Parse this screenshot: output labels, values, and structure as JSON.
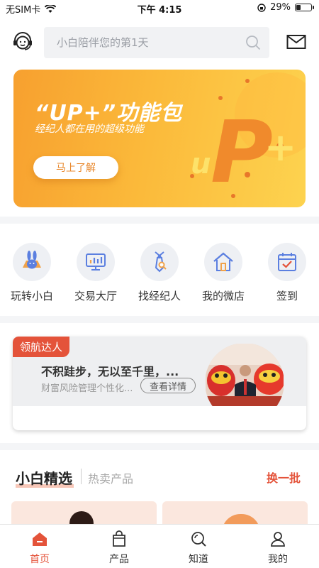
{
  "status_bar": {
    "carrier": "无SIM卡",
    "time": "下午 4:15",
    "battery": "29%",
    "battery_level": 0.29
  },
  "header": {
    "search_placeholder": "小白陪伴您的第1天",
    "icons": [
      "customer-service-icon",
      "search-icon",
      "mail-icon"
    ]
  },
  "banner": {
    "title": "“UP+”功能包",
    "subtitle": "经纪人都在用的超级功能",
    "cta": "马上了解",
    "art_text": "uP+"
  },
  "quick_nav": [
    {
      "label": "玩转小白",
      "icon": "rabbit-icon"
    },
    {
      "label": "交易大厅",
      "icon": "monitor-chart-icon"
    },
    {
      "label": "找经纪人",
      "icon": "tie-icon"
    },
    {
      "label": "我的微店",
      "icon": "house-icon"
    },
    {
      "label": "签到",
      "icon": "calendar-check-icon"
    }
  ],
  "promo_card": {
    "badge": "领航达人",
    "headline": "不积跬步，无以至千里，...",
    "description": "财富风险管理个性化...",
    "detail_button": "查看详情"
  },
  "section": {
    "title": "小白精选",
    "subtitle": "热卖产品",
    "more": "换一批"
  },
  "tab_bar": [
    {
      "label": "首页",
      "icon": "home-icon",
      "active": true
    },
    {
      "label": "产品",
      "icon": "shopping-bag-icon",
      "active": false
    },
    {
      "label": "知道",
      "icon": "search-knowledge-icon",
      "active": false
    },
    {
      "label": "我的",
      "icon": "user-icon",
      "active": false
    }
  ],
  "colors": {
    "accent": "#e4533a",
    "banner_start": "#f7a02f",
    "banner_end": "#fdd34f",
    "icon_blue": "#5b7fe0"
  }
}
